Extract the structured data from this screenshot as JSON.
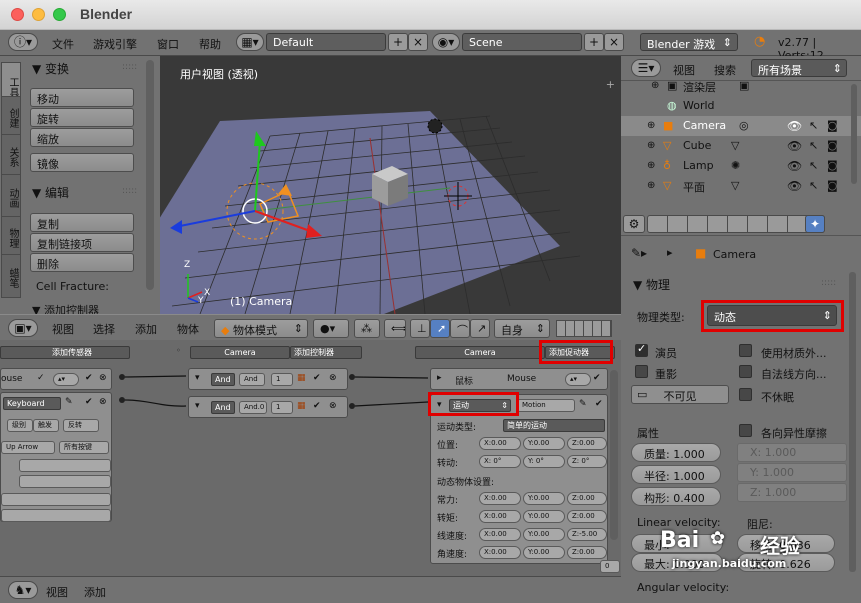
{
  "window": {
    "title": "Blender"
  },
  "topbar": {
    "menus": [
      "文件",
      "游戏引擎",
      "窗口",
      "帮助"
    ],
    "layout": "Default",
    "scene": "Scene",
    "engine": "Blender 游戏",
    "version": "v2.77 | Verts:12"
  },
  "toolshelf": {
    "tabs": [
      "工具",
      "创建",
      "关系",
      "动画",
      "物理",
      "蜡笔"
    ],
    "transform_header": "▼ 变换",
    "transform_buttons": [
      "移动",
      "旋转",
      "缩放",
      "镜像"
    ],
    "edit_header": "▼ 编辑",
    "edit_buttons": [
      "复制",
      "复制链接项",
      "删除"
    ],
    "cell_fracture": "Cell Fracture:",
    "add_controller": "▼ 添加控制器"
  },
  "viewport": {
    "label": "用户视图 (透视)",
    "object_label": "(1) Camera",
    "axis_x": "X",
    "axis_y": "Y",
    "axis_z": "Z"
  },
  "viewheader": {
    "menus": [
      "视图",
      "选择",
      "添加",
      "物体"
    ],
    "mode": "物体模式",
    "orientation": "自身"
  },
  "logic": {
    "sensor_bar": "添加传感器",
    "controller_bar": "Camera",
    "controller_add": "添加控制器",
    "actuator_bar": "Camera",
    "actuator_add": "添加促动器",
    "sensor_partial": "ouse",
    "keyboard": "Keyboard",
    "btn_level": "级别",
    "btn_tap": "触发",
    "btn_invert": "反转",
    "up_arrow": "Up Arrow",
    "all_keys": "所有按键",
    "and_label": "And",
    "and_field": "And",
    "and_field2": "And.0",
    "num_one": "1",
    "num_two": "1",
    "mouse_label": "鼠标",
    "mouse_field": "Mouse",
    "motion_type": "运动",
    "motion_name": "Motion",
    "motion_type_label": "运动类型:",
    "motion_type_value": "简单的运动",
    "loc_label": "位置:",
    "rot_label": "转动:",
    "dyn_label": "动态物体设置:",
    "force_label": "常力:",
    "torque_label": "转矩:",
    "linvel_label": "线速度:",
    "angvel_label": "角速度:",
    "loc_vals": [
      "X:0.00",
      "Y:0.00",
      "Z:0.00"
    ],
    "rot_vals": [
      "X: 0°",
      "Y: 0°",
      "Z: 0°"
    ],
    "force_vals": [
      "X:0.00",
      "Y:0.00",
      "Z:0.00"
    ],
    "torque_vals": [
      "X:0.00",
      "Y:0.00",
      "Z:0.00"
    ],
    "linvel_vals": [
      "X:0.00",
      "Y:0.00",
      "Z:-5.00"
    ],
    "angvel_vals": [
      "X:0.00",
      "Y:0.00",
      "Z:0.00"
    ],
    "scroll_num": "0"
  },
  "footer": {
    "menus": [
      "视图",
      "添加"
    ]
  },
  "outliner": {
    "menus": [
      "视图",
      "搜索"
    ],
    "filter": "所有场景",
    "rows": [
      "渲染层",
      "World",
      "Camera",
      "Cube",
      "Lamp",
      "平面"
    ]
  },
  "properties": {
    "breadcrumb": "Camera",
    "panel": "▼ 物理",
    "physics_type_label": "物理类型:",
    "physics_type": "动态",
    "actor": "演员",
    "use_material": "使用材质外...",
    "ghost": "重影",
    "rot_normal": "自法线方向...",
    "invisible": "不可见",
    "no_sleep": "不休眠",
    "attributes": "属性",
    "anisotropic": "各向异性摩擦",
    "mass": "质量:  1.000",
    "radius": "半径:  1.000",
    "form": "构形:  0.400",
    "aniso_x": "X:      1.000",
    "aniso_y": "Y:      1.000",
    "aniso_z": "Z:      1.000",
    "linear_velocity": "Linear velocity:",
    "damping": "阻尼:",
    "lin_min": "最小:",
    "lin_max": "最大:  0.000",
    "translate": "移动:  0.036",
    "rotate": "旋转:  0.626",
    "angular_velocity": "Angular velocity:"
  },
  "watermark": {
    "brand": "Bai",
    "brand2": "经验",
    "site": "jingyan.baidu.com"
  },
  "colors": {
    "accent": "#5680c2",
    "highlight": "#e00000",
    "panel": "#727272"
  }
}
